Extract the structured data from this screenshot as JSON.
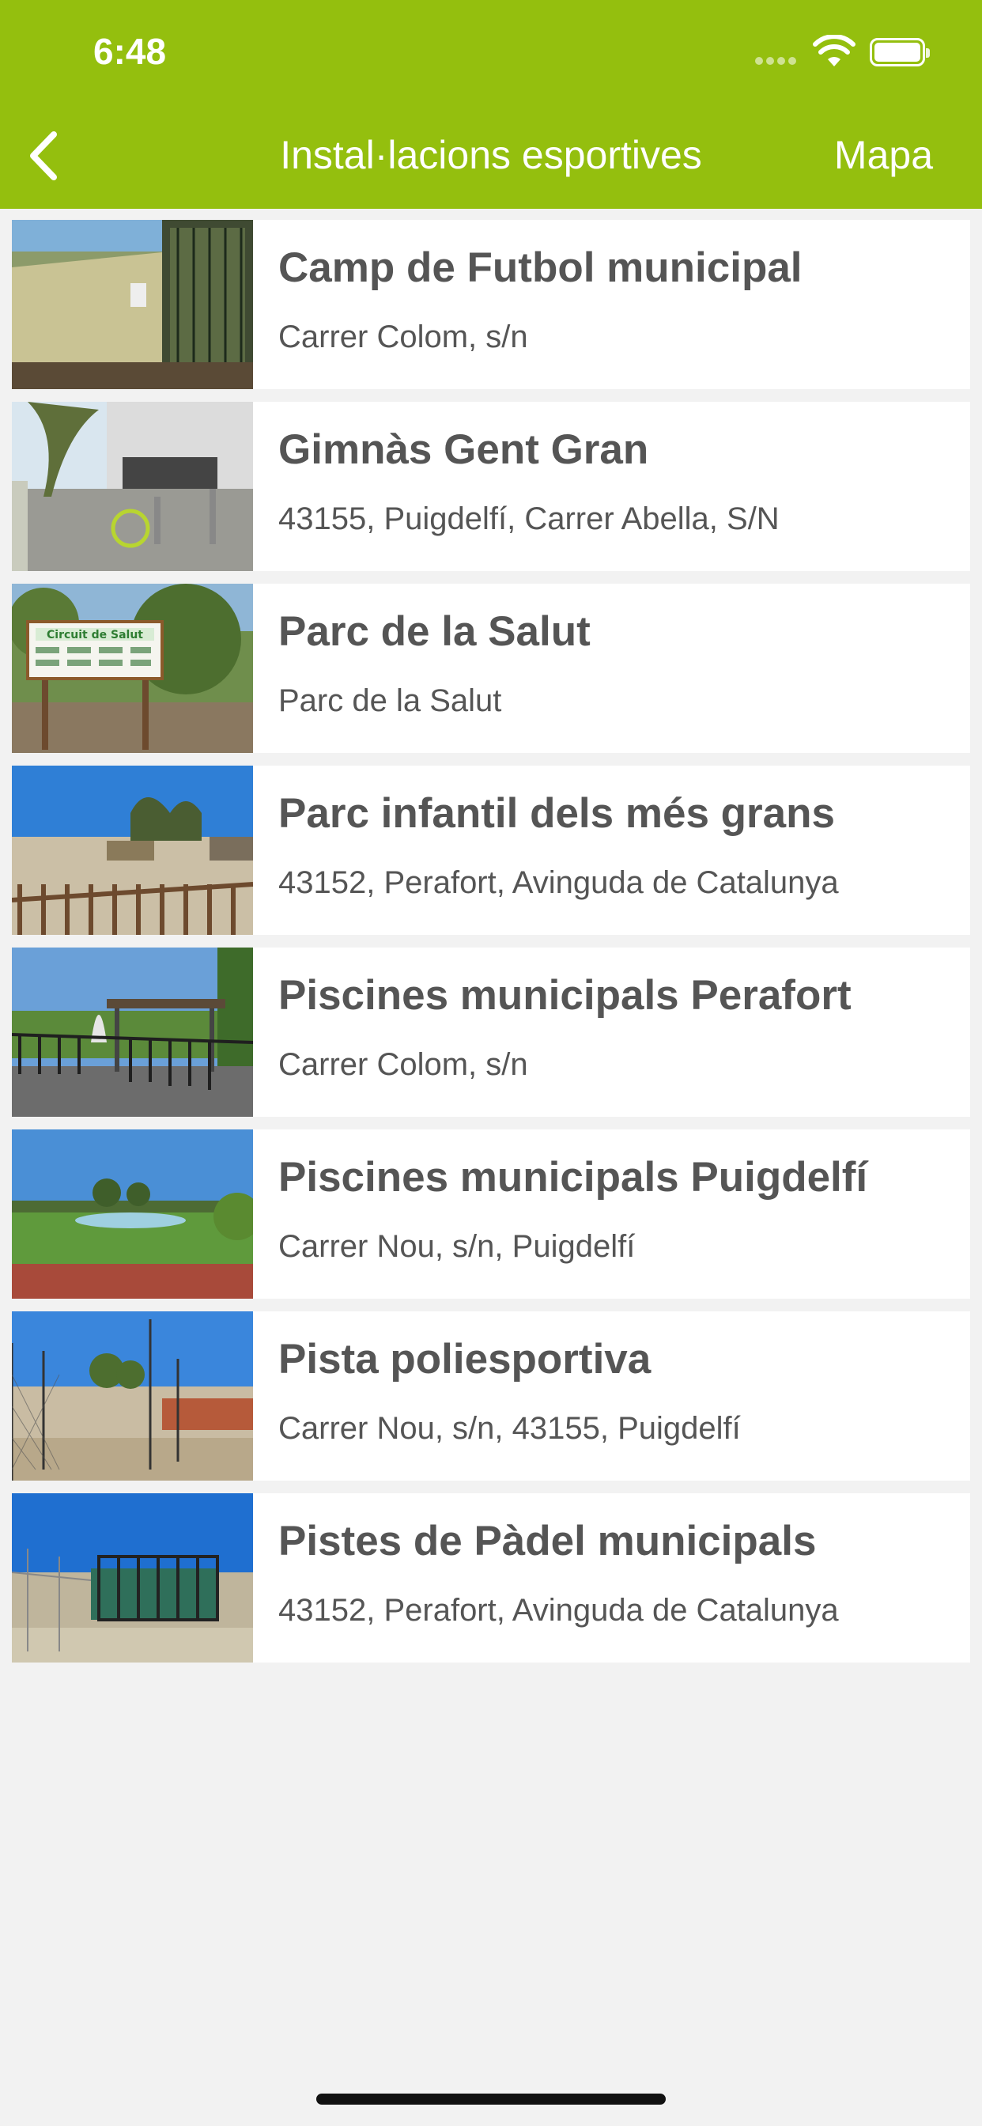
{
  "status_bar": {
    "time": "6:48"
  },
  "nav": {
    "title": "Instal·lacions esportives",
    "right_label": "Mapa",
    "back_icon": "chevron-left-icon"
  },
  "colors": {
    "accent": "#94bf0e",
    "text": "#555555",
    "background": "#f2f2f2"
  },
  "facilities": [
    {
      "title": "Camp de Futbol municipal",
      "address": "Carrer Colom, s/n"
    },
    {
      "title": "Gimnàs Gent Gran",
      "address": "43155, Puigdelfí, Carrer Abella, S/N"
    },
    {
      "title": "Parc de la Salut",
      "address": "Parc de la Salut",
      "sign_text": "Circuit de Salut"
    },
    {
      "title": "Parc infantil dels més grans",
      "address": "43152, Perafort, Avinguda de Catalunya"
    },
    {
      "title": "Piscines municipals Perafort",
      "address": "Carrer Colom, s/n"
    },
    {
      "title": "Piscines municipals Puigdelfí",
      "address": "Carrer Nou, s/n, Puigdelfí"
    },
    {
      "title": "Pista poliesportiva",
      "address": "Carrer Nou, s/n, 43155, Puigdelfí"
    },
    {
      "title": "Pistes de Pàdel municipals",
      "address": "43152, Perafort, Avinguda de Catalunya"
    }
  ]
}
